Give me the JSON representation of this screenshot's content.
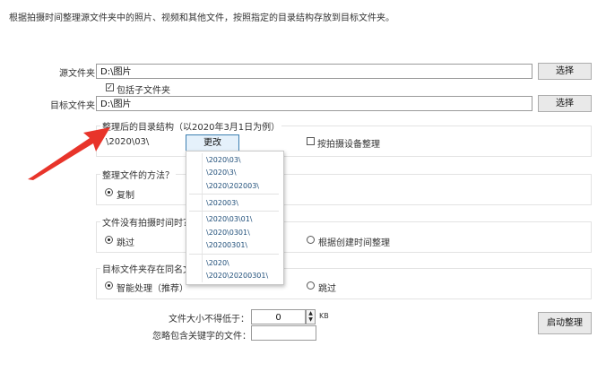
{
  "header": {
    "description": "根据拍摄时间整理源文件夹中的照片、视频和其他文件，按照指定的目录结构存放到目标文件夹。"
  },
  "source": {
    "label": "源文件夹",
    "value": "D:\\图片",
    "button": "选择"
  },
  "include_subfolders": {
    "label": "包括子文件夹",
    "checked": true
  },
  "target": {
    "label": "目标文件夹",
    "value": "D:\\图片",
    "button": "选择"
  },
  "structure": {
    "title": "整理后的目录结构（以2020年3月1日为例）",
    "current": "\\2020\\03\\",
    "change_button": "更改",
    "by_device_label": "按拍摄设备整理",
    "by_device_checked": false
  },
  "dropdown": {
    "items": [
      "\\2020\\03\\",
      "\\2020\\3\\",
      "\\2020\\202003\\",
      "\\202003\\",
      "\\2020\\03\\01\\",
      "\\2020\\0301\\",
      "\\20200301\\",
      "\\2020\\",
      "\\2020\\20200301\\"
    ]
  },
  "method": {
    "title": "整理文件的方法？",
    "option_copy": "复制"
  },
  "no_time": {
    "title": "文件没有拍摄时间时？",
    "option_skip": "跳过",
    "option_created": "根据创建时间整理"
  },
  "conflict": {
    "title": "目标文件夹存在同名文",
    "option_smart": "智能处理（推荐）",
    "option_skip": "跳过"
  },
  "filter": {
    "min_size_label": "文件大小不得低于：",
    "min_size_value": "0",
    "unit": "KB",
    "ignore_label": "忽略包含关键字的文件：",
    "ignore_value": ""
  },
  "start_button": "启动整理",
  "colors": {
    "arrow": "#e8342a",
    "dropdown_text": "#1f4e79"
  }
}
